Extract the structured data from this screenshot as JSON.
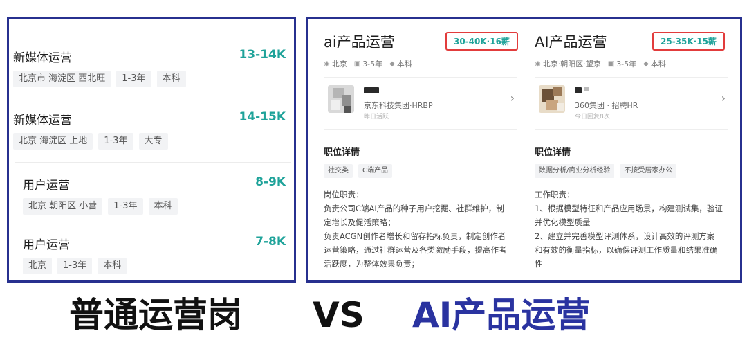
{
  "left_list": [
    {
      "title": "新媒体运营",
      "salary": "13-14K",
      "tags": [
        "北京市 海淀区 西北旺",
        "1-3年",
        "本科"
      ]
    },
    {
      "title": "新媒体运营",
      "salary": "14-15K",
      "tags": [
        "北京 海淀区 上地",
        "1-3年",
        "大专"
      ]
    },
    {
      "title": "用户运营",
      "salary": "8-9K",
      "tags": [
        "北京 朝阳区 小营",
        "1-3年",
        "本科"
      ]
    },
    {
      "title": "用户运营",
      "salary": "7-8K",
      "tags": [
        "北京",
        "1-3年",
        "本科"
      ]
    }
  ],
  "cards": [
    {
      "title": "ai产品运营",
      "salary": "30-40K·16薪",
      "location": "北京",
      "experience": "3-5年",
      "education": "本科",
      "hr_company": "京东科技集团·HRBP",
      "hr_active": "昨日活跃",
      "section_title": "职位详情",
      "skills": [
        "社交类",
        "C端产品"
      ],
      "desc": [
        "岗位职责：",
        "负责公司C端AI产品的种子用户挖掘、社群维护，制",
        "定增长及促活策略；",
        "负责ACGN创作者增长和留存指标负责，制定创作者",
        "运营策略，通过社群运营及各类激励手段，提高作者",
        "活跃度，为整体效果负责；"
      ]
    },
    {
      "title": "AI产品运营",
      "salary": "25-35K·15薪",
      "location": "北京·朝阳区·望京",
      "experience": "3-5年",
      "education": "本科",
      "hr_company": "360集团 · 招聘HR",
      "hr_active": "今日回复8次",
      "section_title": "职位详情",
      "skills": [
        "数据分析/商业分析经验",
        "不接受居家办公"
      ],
      "desc": [
        "工作职责：",
        "1、根据模型特征和产品应用场景，构建测试集，验证",
        "并优化模型质量",
        "2、建立并完善模型评测体系，设计高效的评测方案",
        "和有效的衡量指标，以确保评测工作质量和结果准确",
        "性"
      ]
    }
  ],
  "caption": {
    "left": "普通运营岗",
    "vs": "VS",
    "right": "AI产品运营"
  },
  "icons": {
    "location": "location-pin-icon",
    "experience": "briefcase-icon",
    "education": "graduation-cap-icon",
    "chevron": "chevron-right-icon"
  },
  "colors": {
    "salary": "#1fa39a",
    "frame": "#27308f",
    "highlight": "#e23c3c",
    "caption_right": "#2a33a0"
  }
}
